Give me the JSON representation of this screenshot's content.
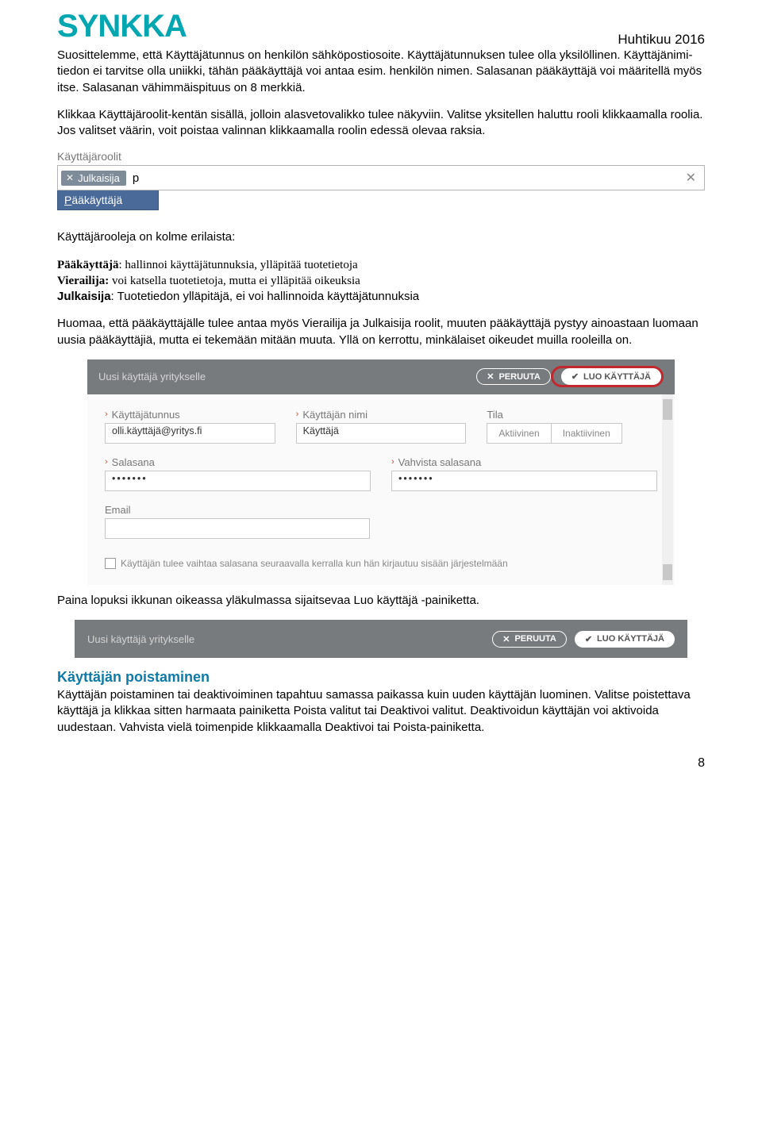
{
  "header": {
    "logo_text": "SYNKKA",
    "date": "Huhtikuu 2016"
  },
  "para1": "Suosittelemme, että Käyttäjätunnus on henkilön sähköpostiosoite. Käyttäjätunnuksen tulee olla yksilöllinen. Käyttäjänimi-tiedon ei tarvitse olla uniikki, tähän pääkäyttäjä voi antaa esim. henkilön nimen. Salasanan pääkäyttäjä voi määritellä myös itse. Salasanan vähimmäispituus on 8 merkkiä.",
  "para2": "Klikkaa Käyttäjäroolit-kentän sisällä, jolloin alasvetovalikko tulee näkyviin. Valitse yksitellen haluttu rooli klikkaamalla roolia. Jos valitset väärin, voit poistaa valinnan klikkaamalla roolin edessä olevaa raksia.",
  "roles_field": {
    "label": "Käyttäjäroolit",
    "chip": "Julkaisija",
    "typed": "p",
    "option_first": "P",
    "option_rest": "ääkäyttäjä"
  },
  "roles_intro": "Käyttäjärooleja on kolme erilaista:",
  "roles_list": {
    "r1_b": "Pääkäyttäjä",
    "r1_t": ": hallinnoi käyttäjätunnuksia, ylläpitää tuotetietoja",
    "r2_b": "Vierailija:",
    "r2_t": " voi katsella tuotetietoja, mutta ei ylläpitää oikeuksia",
    "r3_b": "Julkaisija",
    "r3_t": ": Tuotetiedon ylläpitäjä, ei voi hallinnoida käyttäjätunnuksia"
  },
  "para3": "Huomaa, että pääkäyttäjälle tulee antaa myös Vierailija ja Julkaisija roolit, muuten pääkäyttäjä pystyy ainoastaan luomaan uusia pääkäyttäjiä, mutta ei tekemään mitään muuta. Yllä on kerrottu, minkälaiset oikeudet muilla rooleilla on.",
  "form": {
    "title": "Uusi käyttäjä yritykselle",
    "cancel": "PERUUTA",
    "create": "LUO KÄYTTÄJÄ",
    "f_user": "Käyttäjätunnus",
    "v_user": "olli.käyttäjä@yritys.fi",
    "f_name": "Käyttäjän nimi",
    "v_name": "Käyttäjä",
    "f_status": "Tila",
    "opt_active": "Aktiivinen",
    "opt_inactive": "Inaktiivinen",
    "f_pass": "Salasana",
    "f_pass2": "Vahvista salasana",
    "v_pass": "•••••••",
    "v_pass2": "•••••••",
    "f_email": "Email",
    "checkbox": "Käyttäjän tulee vaihtaa salasana seuraavalla kerralla kun hän kirjautuu sisään järjestelmään"
  },
  "para4": "Paina lopuksi ikkunan oikeassa yläkulmassa sijaitsevaa Luo käyttäjä -painiketta.",
  "section_title": "Käyttäjän poistaminen",
  "para5": "Käyttäjän poistaminen tai deaktivoiminen tapahtuu samassa paikassa kuin uuden käyttäjän luominen. Valitse poistettava käyttäjä ja klikkaa sitten harmaata painiketta Poista valitut tai Deaktivoi valitut. Deaktivoidun käyttäjän voi aktivoida uudestaan. Vahvista vielä toimenpide klikkaamalla Deaktivoi tai Poista-painiketta.",
  "page_number": "8"
}
